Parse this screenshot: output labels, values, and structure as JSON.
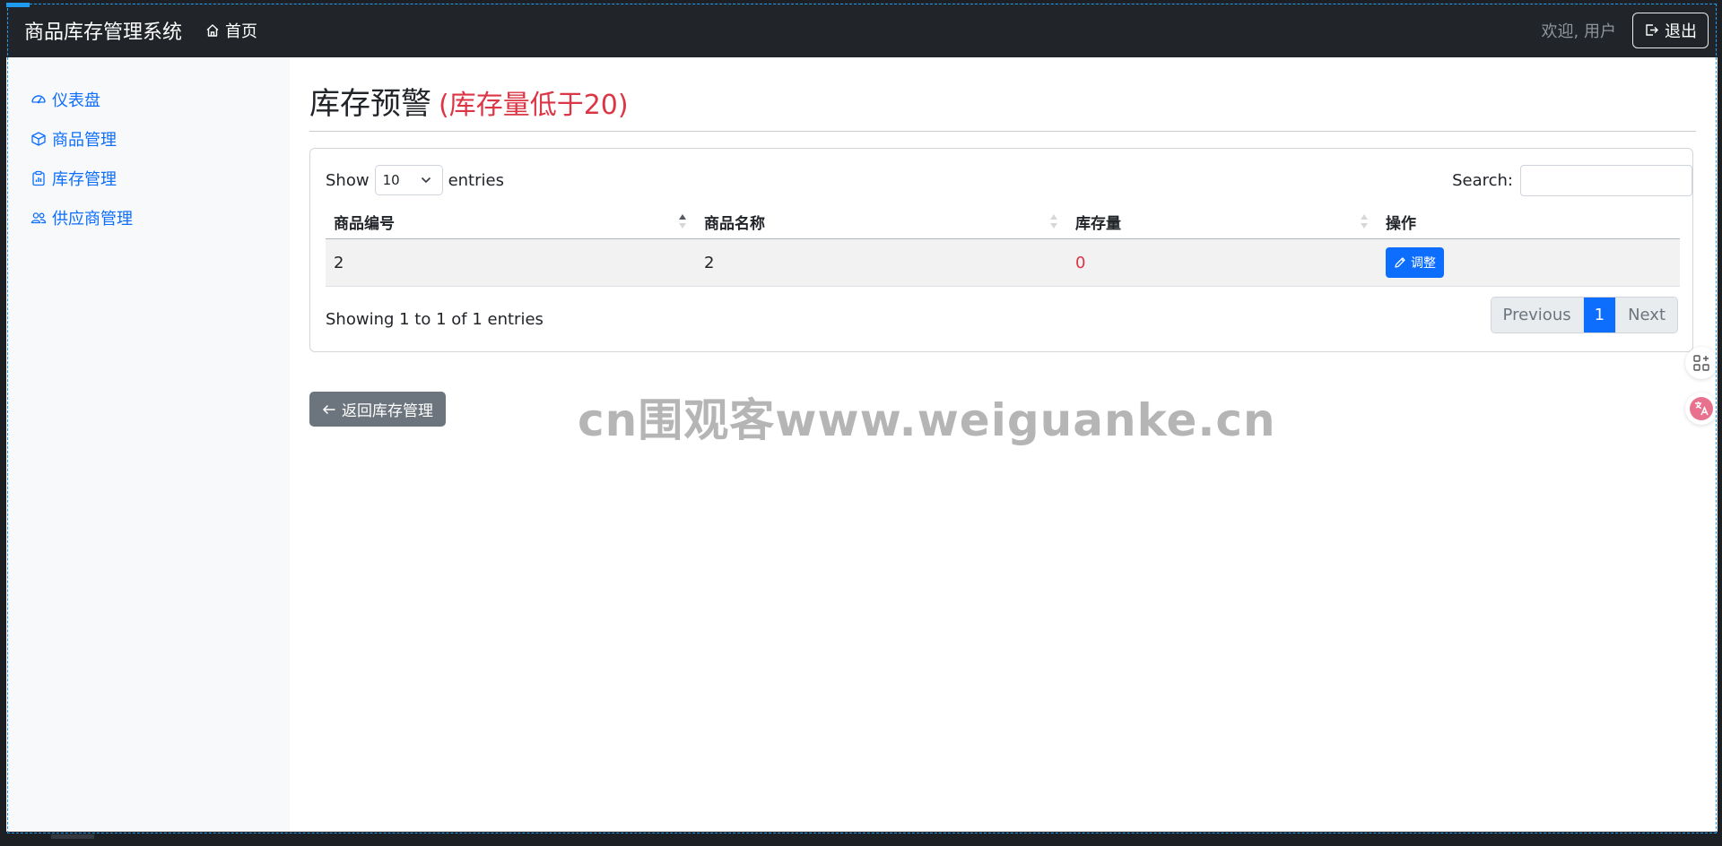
{
  "navbar": {
    "brand": "商品库存管理系统",
    "home_label": "首页",
    "welcome": "欢迎, 用户",
    "logout_label": "退出"
  },
  "sidebar": {
    "items": [
      {
        "label": "仪表盘",
        "icon": "speedometer-icon"
      },
      {
        "label": "商品管理",
        "icon": "box-icon"
      },
      {
        "label": "库存管理",
        "icon": "clipboard-chart-icon"
      },
      {
        "label": "供应商管理",
        "icon": "people-icon"
      }
    ]
  },
  "page": {
    "title": "库存预警",
    "hint": "(库存量低于20)"
  },
  "table_controls": {
    "show_label": "Show",
    "page_length": "10",
    "entries_label": "entries",
    "search_label": "Search:",
    "search_value": ""
  },
  "table": {
    "columns": [
      "商品编号",
      "商品名称",
      "库存量",
      "操作"
    ],
    "rows": [
      {
        "id": "2",
        "name": "2",
        "stock": "0",
        "action_label": "调整"
      }
    ]
  },
  "footer": {
    "info": "Showing 1 to 1 of 1 entries",
    "previous_label": "Previous",
    "current_page": "1",
    "next_label": "Next"
  },
  "back_button_label": "返回库存管理",
  "watermark": "cn围观客www.weiguanke.cn",
  "colors": {
    "navbar": "#212529",
    "primary": "#0d6efd",
    "danger": "#dc3545",
    "secondary": "#6c757d"
  }
}
